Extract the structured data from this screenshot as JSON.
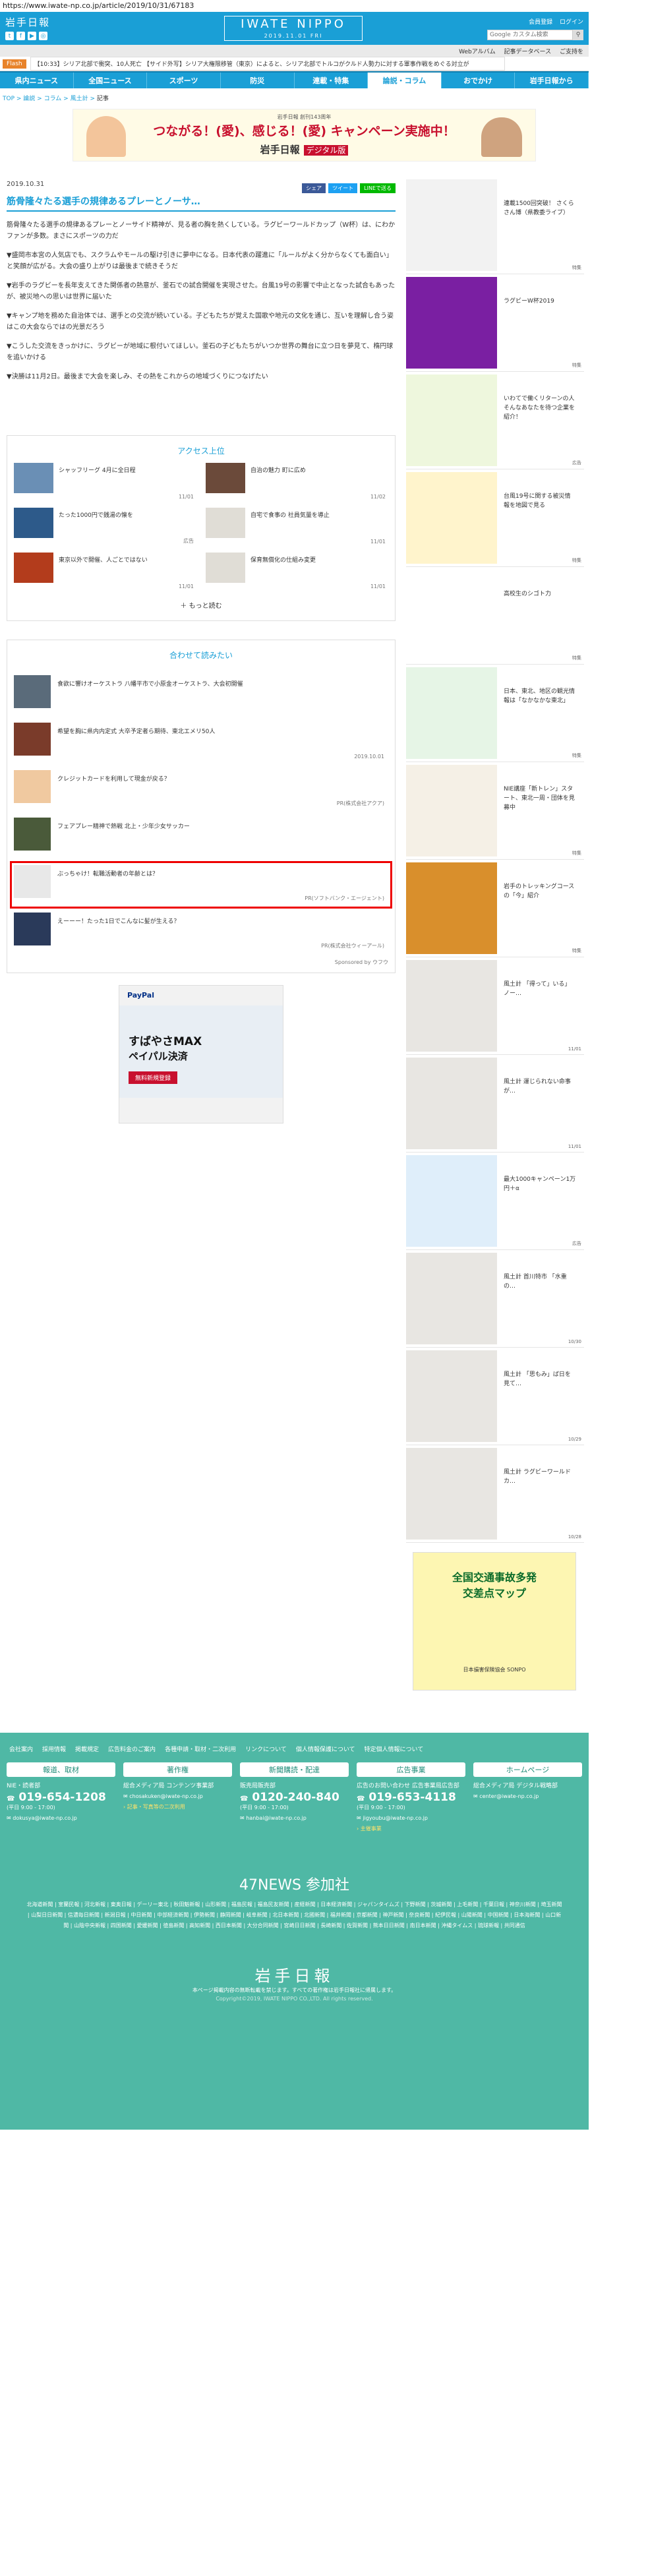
{
  "url": "https://www.iwate-np.co.jp/article/2019/10/31/67183",
  "header": {
    "logo": "岩手日報",
    "center_logo": "IWATE NIPPO",
    "center_date": "2019.11.01 FRI",
    "links": [
      "会員登録",
      "ログイン"
    ],
    "search_placeholder": "Google カスタム検索",
    "search_icon": "search-icon",
    "sub_links": [
      "Webアルバム",
      "記事データベース",
      "ご支持を"
    ]
  },
  "flash": {
    "tag": "Flash",
    "text": "【10:33】シリア北部で衝突、10人死亡 【サイド外写】シリア大権限移管（東京）によると、シリア北部でトルコがクルド人勢力に対する軍事作戦をめぐる対立が"
  },
  "nav": [
    "県内ニュース",
    "全国ニュース",
    "スポーツ",
    "防災",
    "連載・特集",
    "論説・コラム",
    "おでかけ",
    "岩手日報から"
  ],
  "breadcrumb": [
    "TOP",
    "論説",
    "コラム",
    "風土計",
    "記事"
  ],
  "banner": {
    "small": "岩手日報 創刊143周年",
    "main": "つながる！(愛)、感じる！(愛) キャンペーン実施中！",
    "sub": "岩手日報",
    "badge": "デジタル版"
  },
  "article": {
    "date": "2019.10.31",
    "share": [
      "シェア",
      "ツイート",
      "LINEで送る"
    ],
    "title": "筋骨隆々たる選手の規律あるプレーとノーサ…",
    "paragraphs": [
      "筋骨隆々たる選手の規律あるプレーとノーサイド精神が、見る者の胸を熱くしている。ラグビーワールドカップ（W杯）は、にわかファンが多数。まさにスポーツの力だ",
      "▼盛岡市本宮の人気店でも、スクラムやモールの駆け引きに夢中になる。日本代表の躍進に「ルールがよく分からなくても面白い」と笑顔が広がる。大会の盛り上がりは最後まで続きそうだ",
      "▼岩手のラグビーを長年支えてきた関係者の熱意が、釜石での試合開催を実現させた。台風19号の影響で中止となった試合もあったが、被災地への思いは世界に届いた",
      "▼キャンプ地を務めた自治体では、選手との交流が続いている。子どもたちが覚えた国歌や地元の文化を通じ、互いを理解し合う姿はこの大会ならではの光景だろう",
      "▼こうした交流をきっかけに、ラグビーが地域に根付いてほしい。釜石の子どもたちがいつか世界の舞台に立つ日を夢見て、楕円球を追いかける",
      "▼決勝は11月2日。最後まで大会を楽しみ、その熱をこれからの地域づくりにつなげたい"
    ]
  },
  "ranking": {
    "title": "アクセス上位",
    "items": [
      {
        "text": "シャッフリーグ 4月に全日程",
        "time": "11/01"
      },
      {
        "text": "自治の魅力 町に広め",
        "time": "11/02"
      },
      {
        "text": "たった1000円で銭湯の懐を",
        "time": "",
        "tag": "広告"
      },
      {
        "text": "自宅で食事の 社員気量を導止",
        "time": "11/01"
      },
      {
        "text": "東京以外で開催、人ごとではない",
        "time": "11/01"
      },
      {
        "text": "保育無償化の仕組み変更",
        "time": "11/01"
      }
    ],
    "more": "もっと読む"
  },
  "recommend": {
    "title": "合わせて読みたい",
    "items": [
      {
        "text": "食欲に響けオーケストラ 八幡平市で小原金オーケストラ、大会初開催",
        "sub": ""
      },
      {
        "text": "希望を胸に県内内定式 大卒予定者ら期待、東北エメリ50人",
        "sub": "2019.10.01"
      },
      {
        "text": "クレジットカードを利用して現金が戻る？",
        "sub": "PR(株式会社アクア)"
      },
      {
        "text": "フェアプレー精神で熱戦 北上・少年少女サッカー",
        "sub": ""
      },
      {
        "text": "ぶっちゃけ！転職活動者の年齢とは？",
        "sub": "PR(ソフトバンク・エージェント)"
      },
      {
        "text": "えーーー！たった1日でこんなに髪が生える？",
        "sub": "PR(株式会社ウィーアール)"
      }
    ],
    "sponsor": "Sponsored by ウフウ"
  },
  "ad": {
    "brand": "PayPal",
    "line1": "すばやさMAX",
    "line2": "ペイパル決済",
    "btn": "無料新規登録"
  },
  "sidebar": [
    {
      "text": "連載1500回突破！ さくらさん博（県教委ライブ）",
      "tag": "特集",
      "color": "#f2f2f2"
    },
    {
      "text": "ラグビーW杯2019",
      "tag": "特集",
      "color": "#7a1fa2"
    },
    {
      "text": "いわてで働くリターンの人 そんなあなたを待つ企業を紹介！",
      "tag": "広告",
      "color": "#eef7dd"
    },
    {
      "text": "台風19号に関する被災情報を地図で見る",
      "tag": "特集",
      "color": "#fff4cc"
    },
    {
      "text": "高校生のシゴト力",
      "tag": "特集",
      "color": "#ffffff"
    },
    {
      "text": "日本、東北、地区の観光情報は「なかなかな東北」",
      "tag": "特集",
      "color": "#e6f5e6"
    },
    {
      "text": "NIE講座「新トレン」スタート、東北一周・団体を見募中",
      "tag": "特集",
      "color": "#f5f0e6"
    },
    {
      "text": "岩手のトレッキングコースの「今」紹介",
      "tag": "特集",
      "color": "#d98f2c"
    },
    {
      "text": "風土計 「得って」いる」ノー…",
      "tag": "11/01",
      "color": "#e8e6e2"
    },
    {
      "text": "風土計 運じられない命事が…",
      "tag": "11/01",
      "color": "#e8e6e2"
    },
    {
      "text": "最大1000キャンペーン1万円＋α",
      "tag": "広告",
      "color": "#dfeefa"
    },
    {
      "text": "風土計 首川特市 「水重の…",
      "tag": "10/30",
      "color": "#e8e6e2"
    },
    {
      "text": "風土計 「思もみ」ば日を見て…",
      "tag": "10/29",
      "color": "#e8e6e2"
    },
    {
      "text": "風土計 ラグビーワールドカ…",
      "tag": "10/28",
      "color": "#e8e6e2"
    }
  ],
  "side_ad": {
    "line1": "全国交通事故多発",
    "line2": "交差点マップ",
    "sponsor": "日本損害保険協会 SONPO"
  },
  "footer": {
    "links": [
      "会社案内",
      "採用情報",
      "掲載規定",
      "広告料金のご案内",
      "各種申請・取材・二次利用",
      "リンクについて",
      "個人情報保護について",
      "特定個人情報について"
    ],
    "cols": [
      {
        "title": "報道、取材",
        "area": "NIE・読者部",
        "phone": "019-654-1208",
        "hours": "(平日 9:00 - 17:00)",
        "mail": "dokusya@iwate-np.co.jp",
        "extra": ""
      },
      {
        "title": "著作権",
        "area": "総合メディア局 コンテンツ事業部",
        "phone": "",
        "hours": "",
        "mail": "chosakuken@iwate-np.co.jp",
        "extra": "記事・写真等の二次利用"
      },
      {
        "title": "新聞購読・配達",
        "area": "販売局販売部",
        "phone": "0120-240-840",
        "hours": "(平日 9:00 - 17:00)",
        "mail": "hanbai@iwate-np.co.jp",
        "extra": ""
      },
      {
        "title": "広告事業",
        "area": "広告のお問い合わせ 広告事業局広告部",
        "phone": "019-653-4118",
        "hours": "(平日 9:00 - 17:00)",
        "mail": "jigyoubu@iwate-np.co.jp",
        "extra": "主催事業"
      },
      {
        "title": "ホームページ",
        "area": "総合メディア局 デジタル戦略部",
        "phone": "",
        "hours": "",
        "mail": "center@iwate-np.co.jp",
        "extra": ""
      }
    ],
    "n47": "47NEWS 参加社",
    "papers": "北海道新聞 | 室蘭民報 | 河北新報 | 東奥日報 | デーリー東北 | 秋田魁新報 | 山形新聞 | 福島民報 | 福島民友新聞 | 産経新聞 | 日本経済新聞 | ジャパンタイムズ | 下野新聞 | 茨城新聞 | 上毛新聞 | 千葉日報 | 神奈川新聞 | 埼玉新聞 | 山梨日日新聞 | 信濃毎日新聞 | 新潟日報 | 中日新聞 | 中部経済新聞 | 伊勢新聞 | 静岡新聞 | 岐阜新聞 | 北日本新聞 | 北國新聞 | 福井新聞 | 京都新聞 | 神戸新聞 | 奈良新聞 | 紀伊民報 | 山陽新聞 | 中国新聞 | 日本海新聞 | 山口新聞 | 山陰中央新報 | 四国新聞 | 愛媛新聞 | 徳島新聞 | 高知新聞 | 西日本新聞 | 大分合同新聞 | 宮崎日日新聞 | 長崎新聞 | 佐賀新聞 | 熊本日日新聞 | 南日本新聞 | 沖縄タイムス | 琉球新報 | 共同通信",
    "logo": "岩手日報",
    "notice": "本ページ掲載内容の無断転載を禁じます。すべての著作権は岩手日報社に帰属します。",
    "copyright": "Copyright©2019, IWATE NIPPO CO.,LTD. All rights reserved."
  }
}
